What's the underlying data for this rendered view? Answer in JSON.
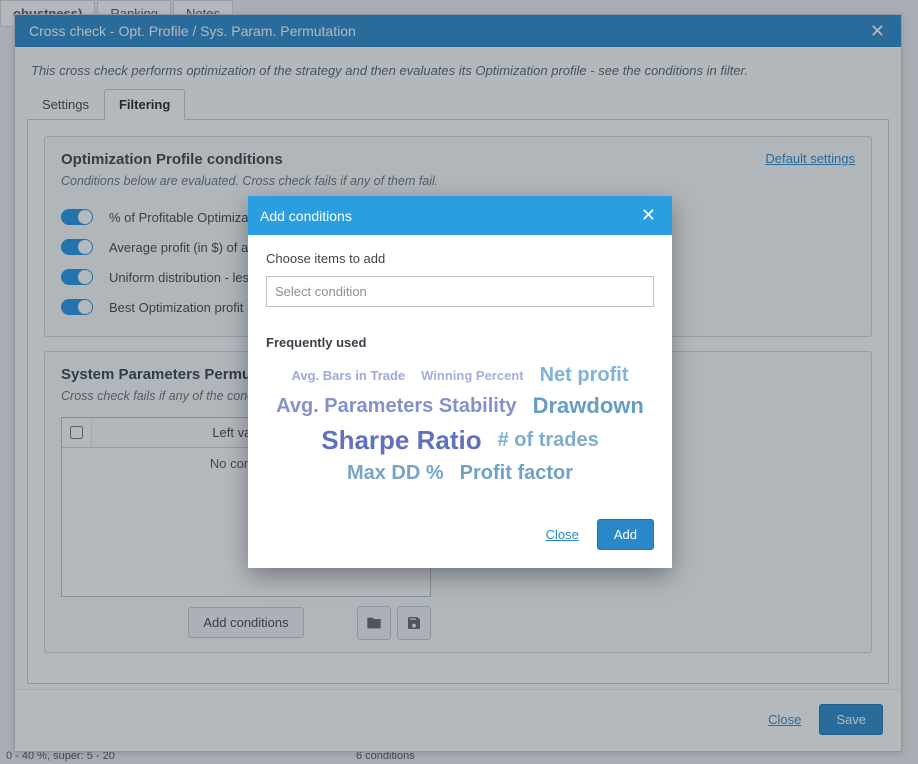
{
  "bgTabs": {
    "robustness": "obustness)",
    "ranking": "Ranking",
    "notes": "Notes"
  },
  "bgBottom": "0 - 40 %, super: 5 - 20",
  "bgCond": "6 conditions",
  "main": {
    "title": "Cross check - Opt. Profile / Sys. Param. Permutation",
    "intro": "This cross check performs optimization of the strategy and then evaluates its Optimization profile - see the conditions in filter.",
    "tabs": {
      "settings": "Settings",
      "filtering": "Filtering"
    },
    "section1": {
      "title": "Optimization Profile conditions",
      "link": "Default settings",
      "sub": "Conditions below are evaluated. Cross check fails if any of them fail.",
      "rows": [
        "% of Profitable Optimizati",
        "Average profit (in $) of all",
        "Uniform distribution - less",
        "Best Optimization profit"
      ]
    },
    "section2": {
      "title": "System Parameters Permutat",
      "sub": "Cross check fails if any of the conditi",
      "thLeft": "Left value",
      "thCmp": "<>",
      "empty": "No condition",
      "addBtn": "Add conditions"
    },
    "footer": {
      "close": "Close",
      "save": "Save"
    }
  },
  "popup": {
    "title": "Add conditions",
    "chooseLabel": "Choose items to add",
    "placeholder": "Select condition",
    "freqLabel": "Frequently used",
    "cloud": {
      "avgBars": "Avg. Bars in Trade",
      "winPct": "Winning Percent",
      "netProfit": "Net profit",
      "avgParams": "Avg. Parameters Stability",
      "drawdown": "Drawdown",
      "sharpe": "Sharpe Ratio",
      "numTrades": "# of trades",
      "maxDD": "Max DD %",
      "profitFactor": "Profit factor"
    },
    "close": "Close",
    "add": "Add"
  }
}
